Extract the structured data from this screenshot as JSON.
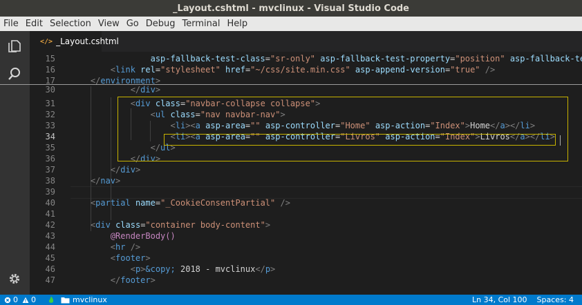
{
  "window": {
    "title": "_Layout.cshtml - mvclinux - Visual Studio Code"
  },
  "menu": [
    "File",
    "Edit",
    "Selection",
    "View",
    "Go",
    "Debug",
    "Terminal",
    "Help"
  ],
  "tab": {
    "label": "_Layout.cshtml"
  },
  "status": {
    "errors": "0",
    "warnings": "0",
    "folder": "mvclinux",
    "position": "Ln 34, Col 100",
    "spaces": "Spaces: 4"
  },
  "editor": {
    "current_line": "34",
    "lines": [
      {
        "num": "15",
        "tokens": [
          [
            "                ",
            ""
          ],
          [
            "asp-fallback-test-class",
            "attr"
          ],
          [
            "=",
            "txt"
          ],
          [
            "\"sr-only\"",
            "str"
          ],
          [
            " ",
            ""
          ],
          [
            "asp-fallback-test-property",
            "attr"
          ],
          [
            "=",
            "txt"
          ],
          [
            "\"position\"",
            "str"
          ],
          [
            " ",
            ""
          ],
          [
            "asp-fallback-test",
            "attr"
          ]
        ]
      },
      {
        "num": "16",
        "tokens": [
          [
            "        ",
            ""
          ],
          [
            "<",
            "punc"
          ],
          [
            "link",
            "tag"
          ],
          [
            " ",
            ""
          ],
          [
            "rel",
            "attr"
          ],
          [
            "=",
            "txt"
          ],
          [
            "\"stylesheet\"",
            "str"
          ],
          [
            " ",
            ""
          ],
          [
            "href",
            "attr"
          ],
          [
            "=",
            "txt"
          ],
          [
            "\"~/css/site.min.css\"",
            "str"
          ],
          [
            " ",
            ""
          ],
          [
            "asp-append-version",
            "attr"
          ],
          [
            "=",
            "txt"
          ],
          [
            "\"true\"",
            "str"
          ],
          [
            " />",
            "punc"
          ]
        ]
      },
      {
        "num": "17",
        "tokens": [
          [
            "    ",
            ""
          ],
          [
            "</",
            "punc"
          ],
          [
            "environment",
            "tag"
          ],
          [
            ">",
            "punc"
          ]
        ]
      },
      {
        "num": "30",
        "tokens": [
          [
            "            ",
            ""
          ],
          [
            "</",
            "punc"
          ],
          [
            "div",
            "tag"
          ],
          [
            ">",
            "punc"
          ]
        ]
      },
      {
        "num": "31",
        "tokens": [
          [
            "            ",
            ""
          ],
          [
            "<",
            "punc"
          ],
          [
            "div",
            "tag"
          ],
          [
            " ",
            ""
          ],
          [
            "class",
            "attr"
          ],
          [
            "=",
            "txt"
          ],
          [
            "\"navbar-collapse collapse\"",
            "str"
          ],
          [
            ">",
            "punc"
          ]
        ]
      },
      {
        "num": "32",
        "tokens": [
          [
            "                ",
            ""
          ],
          [
            "<",
            "punc"
          ],
          [
            "ul",
            "tag"
          ],
          [
            " ",
            ""
          ],
          [
            "class",
            "attr"
          ],
          [
            "=",
            "txt"
          ],
          [
            "\"nav navbar-nav\"",
            "str"
          ],
          [
            ">",
            "punc"
          ]
        ]
      },
      {
        "num": "33",
        "tokens": [
          [
            "                    ",
            ""
          ],
          [
            "<",
            "punc"
          ],
          [
            "li",
            "tag"
          ],
          [
            ">",
            "punc"
          ],
          [
            "<",
            "punc"
          ],
          [
            "a",
            "tag"
          ],
          [
            " ",
            ""
          ],
          [
            "asp-area",
            "attr"
          ],
          [
            "=",
            "txt"
          ],
          [
            "\"\"",
            "str"
          ],
          [
            " ",
            ""
          ],
          [
            "asp-controller",
            "attr"
          ],
          [
            "=",
            "txt"
          ],
          [
            "\"Home\"",
            "str"
          ],
          [
            " ",
            ""
          ],
          [
            "asp-action",
            "attr"
          ],
          [
            "=",
            "txt"
          ],
          [
            "\"Index\"",
            "str"
          ],
          [
            ">",
            "punc"
          ],
          [
            "Home",
            "txt"
          ],
          [
            "</",
            "punc"
          ],
          [
            "a",
            "tag"
          ],
          [
            ">",
            "punc"
          ],
          [
            "</",
            "punc"
          ],
          [
            "li",
            "tag"
          ],
          [
            ">",
            "punc"
          ]
        ]
      },
      {
        "num": "34",
        "tokens": [
          [
            "                    ",
            ""
          ],
          [
            "<",
            "punc"
          ],
          [
            "li",
            "tag"
          ],
          [
            ">",
            "punc"
          ],
          [
            "<",
            "punc"
          ],
          [
            "a",
            "tag"
          ],
          [
            " ",
            ""
          ],
          [
            "asp-area",
            "attr"
          ],
          [
            "=",
            "txt"
          ],
          [
            "\"\"",
            "str"
          ],
          [
            " ",
            ""
          ],
          [
            "asp-controller",
            "attr"
          ],
          [
            "=",
            "txt"
          ],
          [
            "\"Livros\"",
            "str"
          ],
          [
            " ",
            ""
          ],
          [
            "asp-action",
            "attr"
          ],
          [
            "=",
            "txt"
          ],
          [
            "\"Index\"",
            "str"
          ],
          [
            ">",
            "punc"
          ],
          [
            "Livros",
            "txt"
          ],
          [
            "</",
            "punc"
          ],
          [
            "a",
            "tag"
          ],
          [
            ">",
            "punc"
          ],
          [
            "</",
            "punc"
          ],
          [
            "li",
            "tag"
          ],
          [
            ">",
            "punc"
          ]
        ]
      },
      {
        "num": "35",
        "tokens": [
          [
            "                ",
            ""
          ],
          [
            "</",
            "punc"
          ],
          [
            "ul",
            "tag"
          ],
          [
            ">",
            "punc"
          ]
        ]
      },
      {
        "num": "36",
        "tokens": [
          [
            "            ",
            ""
          ],
          [
            "</",
            "punc"
          ],
          [
            "div",
            "tag"
          ],
          [
            ">",
            "punc"
          ]
        ]
      },
      {
        "num": "37",
        "tokens": [
          [
            "        ",
            ""
          ],
          [
            "</",
            "punc"
          ],
          [
            "div",
            "tag"
          ],
          [
            ">",
            "punc"
          ]
        ]
      },
      {
        "num": "38",
        "tokens": [
          [
            "    ",
            ""
          ],
          [
            "</",
            "punc"
          ],
          [
            "nav",
            "tag"
          ],
          [
            ">",
            "punc"
          ]
        ]
      },
      {
        "num": "39",
        "tokens": []
      },
      {
        "num": "40",
        "tokens": [
          [
            "    ",
            ""
          ],
          [
            "<",
            "punc"
          ],
          [
            "partial",
            "tag"
          ],
          [
            " ",
            ""
          ],
          [
            "name",
            "attr"
          ],
          [
            "=",
            "txt"
          ],
          [
            "\"_CookieConsentPartial\"",
            "str"
          ],
          [
            " />",
            "punc"
          ]
        ]
      },
      {
        "num": "41",
        "tokens": []
      },
      {
        "num": "42",
        "tokens": [
          [
            "    ",
            ""
          ],
          [
            "<",
            "punc"
          ],
          [
            "div",
            "tag"
          ],
          [
            " ",
            ""
          ],
          [
            "class",
            "attr"
          ],
          [
            "=",
            "txt"
          ],
          [
            "\"container body-content\"",
            "str"
          ],
          [
            ">",
            "punc"
          ]
        ]
      },
      {
        "num": "43",
        "tokens": [
          [
            "        ",
            ""
          ],
          [
            "@RenderBody()",
            "razor"
          ]
        ]
      },
      {
        "num": "44",
        "tokens": [
          [
            "        ",
            ""
          ],
          [
            "<",
            "punc"
          ],
          [
            "hr",
            "tag"
          ],
          [
            " />",
            "punc"
          ]
        ]
      },
      {
        "num": "45",
        "tokens": [
          [
            "        ",
            ""
          ],
          [
            "<",
            "punc"
          ],
          [
            "footer",
            "tag"
          ],
          [
            ">",
            "punc"
          ]
        ]
      },
      {
        "num": "46",
        "tokens": [
          [
            "            ",
            ""
          ],
          [
            "<",
            "punc"
          ],
          [
            "p",
            "tag"
          ],
          [
            ">",
            "punc"
          ],
          [
            "&copy;",
            "ent"
          ],
          [
            " 2018 - mvclinux",
            "txt"
          ],
          [
            "</",
            "punc"
          ],
          [
            "p",
            "tag"
          ],
          [
            ">",
            "punc"
          ]
        ]
      },
      {
        "num": "47",
        "tokens": [
          [
            "        ",
            ""
          ],
          [
            "</",
            "punc"
          ],
          [
            "footer",
            "tag"
          ],
          [
            ">",
            "punc"
          ]
        ]
      }
    ]
  },
  "colors": {
    "tag": "#569cd6",
    "attr": "#9cdcfe",
    "string": "#ce9178",
    "highlight_box": "#c9b400",
    "statusbar": "#007acc"
  },
  "icons": [
    "explorer-icon",
    "search-icon",
    "gear-icon",
    "error-icon",
    "warning-icon",
    "folder-icon",
    "html-file-icon"
  ]
}
